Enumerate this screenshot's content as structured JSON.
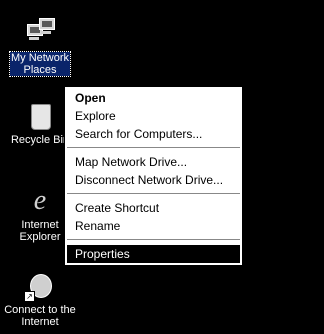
{
  "desktop": {
    "background_color": "#000000",
    "icons": [
      {
        "label": "My Network\nPlaces",
        "icon": "network-places-icon"
      },
      {
        "label": "Recycle Bin",
        "icon": "recycle-bin-icon"
      },
      {
        "label": "Internet\nExplorer",
        "icon": "internet-explorer-icon"
      },
      {
        "label": "Connect to the\nInternet",
        "icon": "connect-internet-icon"
      }
    ]
  },
  "context_menu": {
    "items": [
      {
        "label": "Open"
      },
      {
        "label": "Explore"
      },
      {
        "label": "Search for Computers..."
      },
      {
        "label": "Map Network Drive..."
      },
      {
        "label": "Disconnect Network Drive..."
      },
      {
        "label": "Create Shortcut"
      },
      {
        "label": "Rename"
      },
      {
        "label": "Properties"
      }
    ]
  }
}
